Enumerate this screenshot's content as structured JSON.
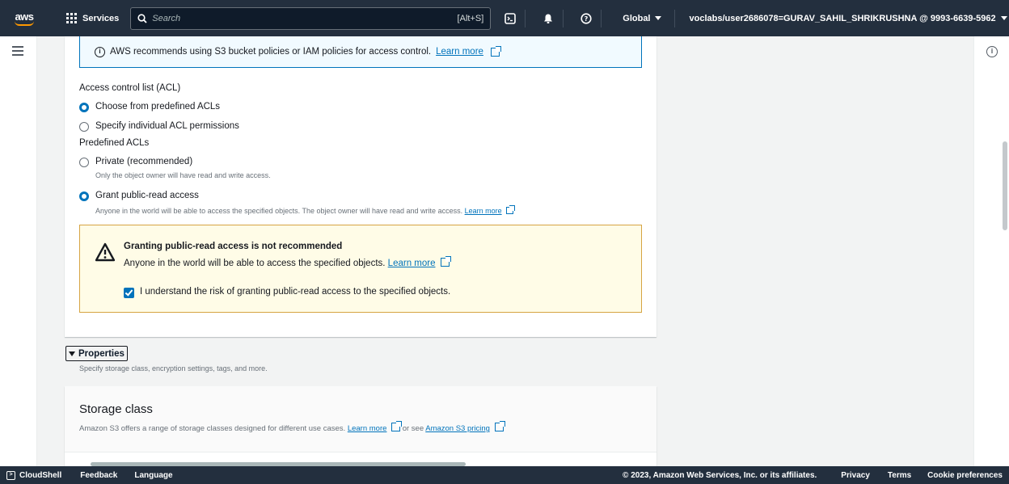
{
  "topnav": {
    "logo": "aws",
    "services": "Services",
    "search_placeholder": "Search",
    "search_shortcut": "[Alt+S]",
    "region": "Global",
    "account": "voclabs/user2686078=GURAV_SAHIL_SHRIKRUSHNA @ 9993-6639-5962"
  },
  "info_banner": {
    "text": "AWS recommends using S3 bucket policies or IAM policies for access control.",
    "link": "Learn more"
  },
  "acl": {
    "heading": "Access control list (ACL)",
    "options": [
      {
        "label": "Choose from predefined ACLs",
        "selected": true
      },
      {
        "label": "Specify individual ACL permissions",
        "selected": false
      }
    ],
    "predefined_heading": "Predefined ACLs",
    "predefined": [
      {
        "label": "Private (recommended)",
        "desc": "Only the object owner will have read and write access.",
        "selected": false
      },
      {
        "label": "Grant public-read access",
        "desc": "Anyone in the world will be able to access the specified objects. The object owner will have read and write access.",
        "link": "Learn more",
        "selected": true
      }
    ]
  },
  "warning": {
    "title": "Granting public-read access is not recommended",
    "text": "Anyone in the world will be able to access the specified objects.",
    "link": "Learn more",
    "checkbox_label": "I understand the risk of granting public-read access to the specified objects.",
    "checked": true
  },
  "properties": {
    "toggle": "Properties",
    "desc": "Specify storage class, encryption settings, tags, and more."
  },
  "storage_class": {
    "title": "Storage class",
    "desc": "Amazon S3 offers a range of storage classes designed for different use cases.",
    "link1": "Learn more",
    "mid": "or see",
    "link2": "Amazon S3 pricing"
  },
  "footer": {
    "cloudshell": "CloudShell",
    "feedback": "Feedback",
    "language": "Language",
    "copyright": "© 2023, Amazon Web Services, Inc. or its affiliates.",
    "privacy": "Privacy",
    "terms": "Terms",
    "cookies": "Cookie preferences"
  },
  "colors": {
    "nav_bg": "#232f3e",
    "link": "#0073bb",
    "warning_bg": "#fffce7",
    "warning_border": "#d6a442"
  }
}
